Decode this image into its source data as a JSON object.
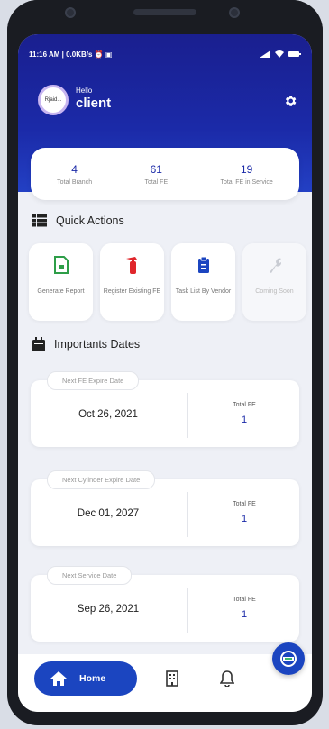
{
  "status_bar": {
    "time_text": "11:16 AM | 0.0KB/s ⏰ ▣",
    "icons": [
      "signal-icon",
      "wifi-icon",
      "battery-icon"
    ]
  },
  "header": {
    "avatar_text": "Rjaid...",
    "greeting": "Hello",
    "username": "client"
  },
  "stats": [
    {
      "value": "4",
      "label": "Total Branch"
    },
    {
      "value": "61",
      "label": "Total FE"
    },
    {
      "value": "19",
      "label": "Total FE in Service"
    }
  ],
  "quick_actions": {
    "title": "Quick Actions",
    "items": [
      {
        "label": "Generate Report",
        "icon": "report-icon"
      },
      {
        "label": "Register Existing FE",
        "icon": "extinguisher-icon"
      },
      {
        "label": "Task List By Vendor",
        "icon": "clipboard-icon"
      },
      {
        "label": "Coming Soon",
        "icon": "wrench-icon"
      }
    ]
  },
  "important_dates": {
    "title": "Importants Dates",
    "cards": [
      {
        "tag": "Next FE Expire Date",
        "date": "Oct 26, 2021",
        "total_label": "Total FE",
        "total_value": "1"
      },
      {
        "tag": "Next Cylinder Expire Date",
        "date": "Dec 01, 2027",
        "total_label": "Total FE",
        "total_value": "1"
      },
      {
        "tag": "Next Service Date",
        "date": "Sep 26, 2021",
        "total_label": "Total FE",
        "total_value": "1"
      }
    ]
  },
  "bottom_nav": {
    "home_label": "Home"
  },
  "colors": {
    "primary": "#1b2aa8",
    "accent": "#1b45c0",
    "extinguisher": "#e0262b",
    "report": "#2e9e48"
  }
}
